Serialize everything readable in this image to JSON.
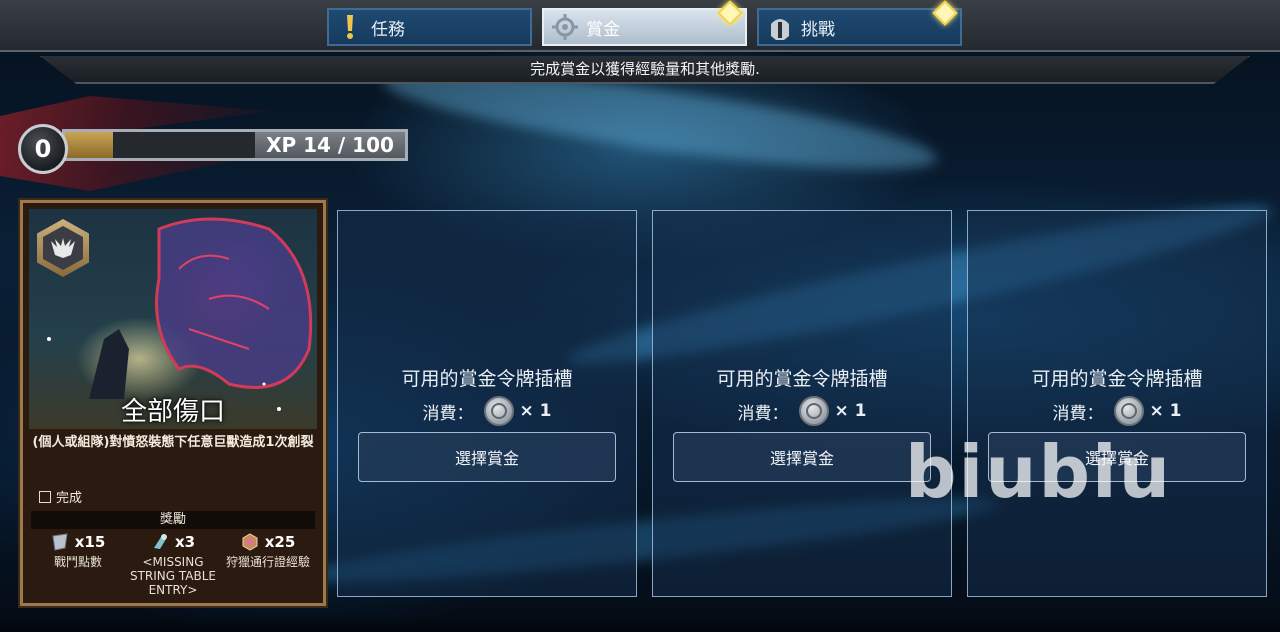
{
  "tabs": [
    {
      "label": "任務",
      "icon": "exclamation-icon",
      "active": false,
      "has_marker": false
    },
    {
      "label": "賞金",
      "icon": "crosshair-icon",
      "active": true,
      "has_marker": true
    },
    {
      "label": "挑戰",
      "icon": "helmet-icon",
      "active": false,
      "has_marker": true
    }
  ],
  "subtitle": "完成賞金以獲得經驗量和其他獎勵.",
  "xp": {
    "level": "0",
    "text": "XP 14 / 100",
    "progress": 0.14
  },
  "card": {
    "title": "全部傷口",
    "description": "(個人或組隊)對憤怒裝態下任意巨獸造成1次創裂",
    "complete_label": "完成",
    "rewards_label": "獎勵",
    "rewards": [
      {
        "icon": "combat-points-icon",
        "count": "x15",
        "name": "戰鬥點數"
      },
      {
        "icon": "item-icon",
        "count": "x3",
        "name": "<MISSING STRING TABLE ENTRY>"
      },
      {
        "icon": "hunt-pass-xp-icon",
        "count": "x25",
        "name": "狩獵通行證經驗"
      }
    ]
  },
  "slots": [
    {
      "title": "可用的賞金令牌插槽",
      "cost_label": "消費：",
      "cost_qty": "× 1",
      "button": "選擇賞金"
    },
    {
      "title": "可用的賞金令牌插槽",
      "cost_label": "消費：",
      "cost_qty": "× 1",
      "button": "選擇賞金"
    },
    {
      "title": "可用的賞金令牌插槽",
      "cost_label": "消費：",
      "cost_qty": "× 1",
      "button": "選擇賞金"
    }
  ],
  "watermark": "biubiu",
  "colors": {
    "tab_bg": "#163a5c",
    "tab_active_bg": "#c7d3df",
    "marker": "#fff6b8",
    "card_border": "#9d7a4a"
  }
}
